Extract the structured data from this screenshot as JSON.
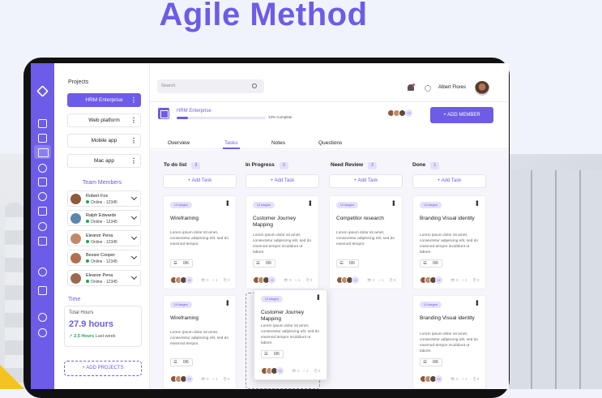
{
  "headline": "Agile Method",
  "sidebar": {
    "projects_title": "Projects",
    "projects": [
      "HRM Enterprise",
      "Web platform",
      "Mobile app",
      "Mac app"
    ],
    "team_title": "Team Members",
    "members": [
      {
        "name": "Robert Fox",
        "status": "Online",
        "id": "12345",
        "color": "#8d5a3b"
      },
      {
        "name": "Ralph Edwards",
        "status": "Online",
        "id": "12345",
        "color": "#5a86b0"
      },
      {
        "name": "Eleanor Pena",
        "status": "Online",
        "id": "12345",
        "color": "#c08a6a"
      },
      {
        "name": "Bessie Cooper",
        "status": "Online",
        "id": "12345",
        "color": "#b07050"
      },
      {
        "name": "Eleanor Pena",
        "status": "Online",
        "id": "12345",
        "color": "#9a6a4f"
      }
    ],
    "time_title": "Time",
    "time": {
      "label": "Total Hours",
      "value": "27.9 hours",
      "delta": "2.5 Hours",
      "delta_suffix": "Last week"
    },
    "add_projects": "+ ADD PROJECTS"
  },
  "topbar": {
    "search_placeholder": "Search",
    "user_name": "Albert Flores"
  },
  "project": {
    "name": "HRM Enterprise",
    "progress": 0.13,
    "progress_label": "13% Complete",
    "more": "+2",
    "add_member": "+ ADD MEMBER"
  },
  "tabs": [
    "Overview",
    "Tasks",
    "Notes",
    "Questions"
  ],
  "columns": [
    {
      "title": "To do list",
      "count": "3"
    },
    {
      "title": "In Progress",
      "count": "3"
    },
    {
      "title": "Need Review",
      "count": "2"
    },
    {
      "title": "Done",
      "count": "1"
    }
  ],
  "add_task": "+ Add Task",
  "card_text": {
    "tag": "UI stages",
    "desc": "Lorem ipsum dolor sit amet, consectetur adipiscing elit, sed do eiusmod tempor.",
    "desc_long": "Lorem ipsum dolor sit amet, consectetur adipiscing elit, sed do eiusmod tempor incididunt ut labore.",
    "checklist": "0/6",
    "more": "+2",
    "stat_a": "0",
    "stat_b": "1",
    "stat_c": "0"
  },
  "cards": {
    "c1": "Wireframing",
    "c2": "Customer Journey Mapping",
    "c3": "Competitor research",
    "c4": "Branding Visual identity",
    "c5": "Wireframing",
    "c6": "Customer Journey Mapping",
    "c7": "Branding Visual identity"
  },
  "colors": {
    "accent": "#6c5ce7",
    "online": "#21a356"
  }
}
